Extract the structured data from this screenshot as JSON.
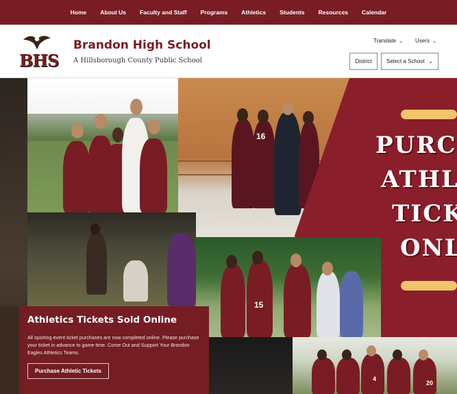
{
  "nav": {
    "items": [
      {
        "label": "Home"
      },
      {
        "label": "About Us"
      },
      {
        "label": "Faculty and Staff"
      },
      {
        "label": "Programs"
      },
      {
        "label": "Athletics"
      },
      {
        "label": "Students"
      },
      {
        "label": "Resources"
      },
      {
        "label": "Calendar"
      }
    ]
  },
  "header": {
    "logo_text": "BHS",
    "school_name": "Brandon High School",
    "school_subtitle": "A Hillsborough County Public School",
    "translate_label": "Translate",
    "users_label": "Users",
    "district_label": "District",
    "select_school_label": "Select a School"
  },
  "hero": {
    "banner_lines": [
      "PURC",
      "ATHL",
      "TICK",
      "ONL"
    ],
    "title": "Athletics Tickets Sold Online",
    "body": "All sporting event ticket purchases are now completed online. Please purchase your ticket in advance to game time. Come Out and Support Your Brandon Eagles Athletics Teams.",
    "cta_label": "Purchase Athletic Tickets",
    "jersey_numbers": [
      "16",
      "15",
      "4",
      "20"
    ]
  },
  "colors": {
    "brand": "#7a1c24",
    "accent": "#f2c46b",
    "white": "#ffffff"
  },
  "icons": {
    "translate_chevron": "chevron-down-icon",
    "users_chevron": "chevron-down-icon",
    "select_chevron": "chevron-down-icon",
    "logo_mascot": "eagle-icon"
  }
}
